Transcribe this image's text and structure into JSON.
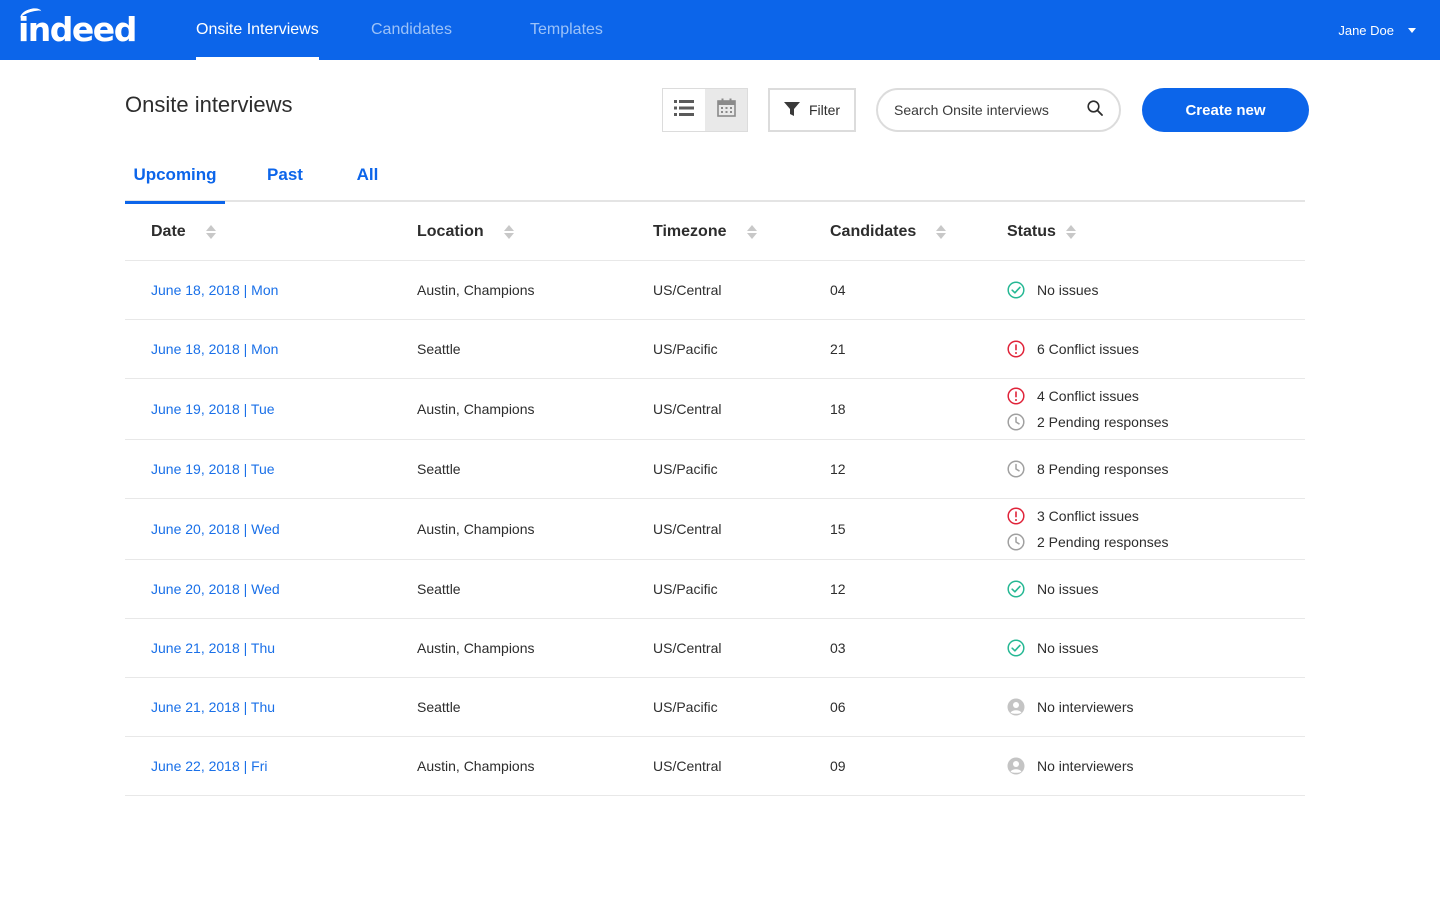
{
  "brand": {
    "logo_text": "indeed"
  },
  "nav": {
    "tabs": [
      {
        "label": "Onsite Interviews",
        "active": true
      },
      {
        "label": "Candidates",
        "active": false
      },
      {
        "label": "Templates",
        "active": false
      }
    ],
    "user": {
      "name": "Jane Doe"
    }
  },
  "header": {
    "title": "Onsite interviews",
    "filter_label": "Filter",
    "search_placeholder": "Search Onsite interviews",
    "create_label": "Create new"
  },
  "subtabs": [
    {
      "label": "Upcoming",
      "active": true
    },
    {
      "label": "Past",
      "active": false
    },
    {
      "label": "All",
      "active": false
    }
  ],
  "table": {
    "columns": [
      "Date",
      "Location",
      "Timezone",
      "Candidates",
      "Status"
    ],
    "rows": [
      {
        "date": "June 18, 2018  |  Mon",
        "location": "Austin, Champions",
        "timezone": "US/Central",
        "candidates": "04",
        "status": [
          {
            "type": "ok",
            "text": "No issues"
          }
        ]
      },
      {
        "date": "June 18, 2018  |  Mon",
        "location": "Seattle",
        "timezone": "US/Pacific",
        "candidates": "21",
        "status": [
          {
            "type": "conflict",
            "text": "6 Conflict issues"
          }
        ]
      },
      {
        "date": "June 19, 2018  |  Tue",
        "location": "Austin, Champions",
        "timezone": "US/Central",
        "candidates": "18",
        "status": [
          {
            "type": "conflict",
            "text": "4 Conflict issues"
          },
          {
            "type": "pending",
            "text": "2 Pending responses"
          }
        ]
      },
      {
        "date": "June 19, 2018  |  Tue",
        "location": "Seattle",
        "timezone": "US/Pacific",
        "candidates": "12",
        "status": [
          {
            "type": "pending",
            "text": "8 Pending responses"
          }
        ]
      },
      {
        "date": "June 20, 2018  |  Wed",
        "location": "Austin, Champions",
        "timezone": "US/Central",
        "candidates": "15",
        "status": [
          {
            "type": "conflict",
            "text": "3 Conflict issues"
          },
          {
            "type": "pending",
            "text": "2 Pending responses"
          }
        ]
      },
      {
        "date": "June 20, 2018  |  Wed",
        "location": "Seattle",
        "timezone": "US/Pacific",
        "candidates": "12",
        "status": [
          {
            "type": "ok",
            "text": "No issues"
          }
        ]
      },
      {
        "date": "June 21, 2018  |  Thu",
        "location": "Austin, Champions",
        "timezone": "US/Central",
        "candidates": "03",
        "status": [
          {
            "type": "ok",
            "text": "No issues"
          }
        ]
      },
      {
        "date": "June 21, 2018  |  Thu",
        "location": "Seattle",
        "timezone": "US/Pacific",
        "candidates": "06",
        "status": [
          {
            "type": "nointerviewers",
            "text": "No interviewers"
          }
        ]
      },
      {
        "date": "June 22, 2018  |  Fri",
        "location": "Austin, Champions",
        "timezone": "US/Central",
        "candidates": "09",
        "status": [
          {
            "type": "nointerviewers",
            "text": "No interviewers"
          }
        ]
      }
    ]
  },
  "colors": {
    "brand_blue": "#0c65ea",
    "link_blue": "#1a70e8",
    "ok_green": "#26b894",
    "conflict_red": "#e0243a",
    "pending_gray": "#a0a0a0"
  }
}
